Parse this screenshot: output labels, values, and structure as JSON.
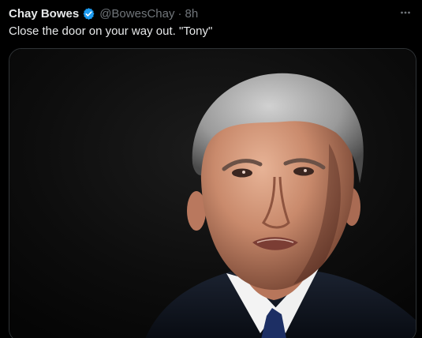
{
  "tweet": {
    "display_name": "Chay Bowes",
    "verified_icon": "verified-badge-icon",
    "handle": "@BowesChay",
    "separator": "·",
    "time": "8h",
    "more_icon": "more-options-icon",
    "text": "Close the door on your way out. \"Tony\"",
    "media": {
      "icon": "photo-image",
      "subject": "photo of a grey-haired man in a dark suit and tie against a dark background"
    }
  },
  "colors": {
    "background": "#000000",
    "text": "#e7e9ea",
    "secondary_text": "#71767b",
    "verified_blue": "#1d9bf0",
    "media_border": "#2f3336"
  }
}
